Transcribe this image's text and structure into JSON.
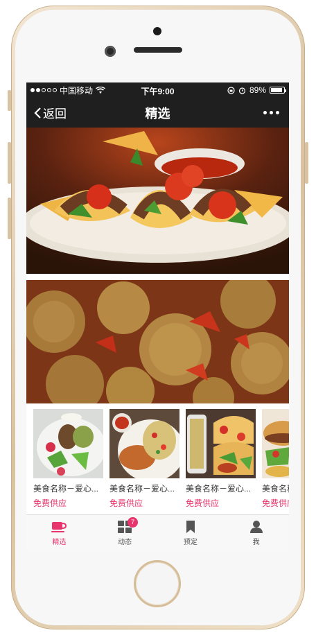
{
  "status_bar": {
    "carrier": "中国移动",
    "time": "下午9:00",
    "battery": "89%",
    "battery_level": 0.89
  },
  "nav": {
    "back_label": "返回",
    "title": "精选"
  },
  "thumbnails": [
    {
      "name": "美食名称－爱心...",
      "tag": "免费供应"
    },
    {
      "name": "美食名称－爱心...",
      "tag": "免费供应"
    },
    {
      "name": "美食名称－爱心...",
      "tag": "免费供应"
    },
    {
      "name": "美食名称－爱心...",
      "tag": "免费供应"
    }
  ],
  "tabs": [
    {
      "label": "精选",
      "icon": "coffee-cup-icon",
      "active": true
    },
    {
      "label": "动态",
      "icon": "grid-icon",
      "badge": "7"
    },
    {
      "label": "预定",
      "icon": "bookmark-icon"
    },
    {
      "label": "我",
      "icon": "person-icon"
    }
  ],
  "colors": {
    "accent": "#e8356d",
    "bar_dark": "#1f1f1f"
  }
}
